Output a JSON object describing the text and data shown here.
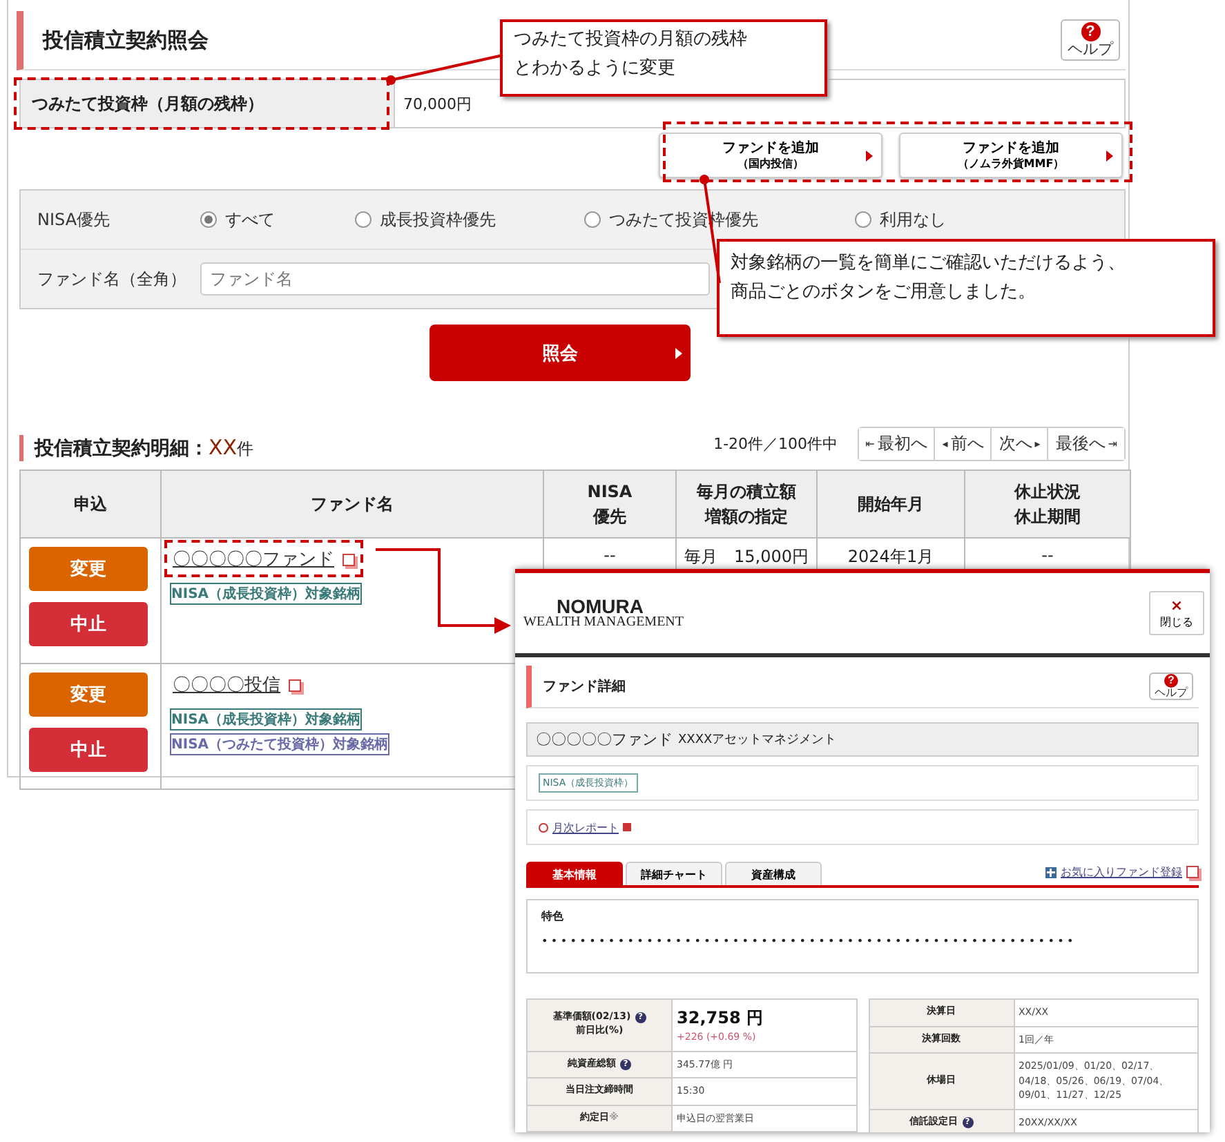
{
  "page": {
    "title": "投信積立契約照会",
    "help": {
      "label": "ヘルプ",
      "icon": "?"
    },
    "quota": {
      "label": "つみたて投資枠（月額の残枠）",
      "value": "70,000円"
    },
    "add_buttons": [
      {
        "line1": "ファンドを追加",
        "line2": "（国内投信）"
      },
      {
        "line1": "ファンドを追加",
        "line2": "（ノムラ外貨MMF）"
      }
    ],
    "filter": {
      "nisa_label": "NISA優先",
      "options": [
        {
          "label": "すべて",
          "selected": true
        },
        {
          "label": "成長投資枠優先",
          "selected": false
        },
        {
          "label": "つみたて投資枠優先",
          "selected": false
        },
        {
          "label": "利用なし",
          "selected": false
        }
      ],
      "fund_label": "ファンド名（全角）",
      "fund_placeholder": "ファンド名"
    },
    "submit": "照会",
    "details": {
      "title": "投信積立契約明細：",
      "count": "XX",
      "count_suffix": "件",
      "range": "1-20件／100件中",
      "pager": [
        {
          "label": "最初へ",
          "kind": "first",
          "icon": "⇤"
        },
        {
          "label": "前へ",
          "kind": "prev",
          "icon": "◂"
        },
        {
          "label": "次へ",
          "kind": "next",
          "icon": "▸"
        },
        {
          "label": "最後へ",
          "kind": "last",
          "icon": "⇥"
        }
      ]
    },
    "table": {
      "columns": [
        [
          "申込"
        ],
        [
          "ファンド名"
        ],
        [
          "NISA",
          "優先"
        ],
        [
          "毎月の積立額",
          "増額の指定"
        ],
        [
          "開始年月"
        ],
        [
          "休止状況",
          "休止期間"
        ]
      ],
      "rows": [
        {
          "apply": [
            {
              "label": "変更",
              "kind": "change"
            },
            {
              "label": "中止",
              "kind": "stop"
            }
          ],
          "fund": {
            "name": "〇〇〇〇〇ファンド",
            "tags": [
              {
                "label": "NISA（成長投資枠）対象銘柄",
                "color": "#3a7a78"
              }
            ]
          },
          "nisa": "--",
          "amount": "毎月　15,000円",
          "start": "2024年1月",
          "status": "--"
        },
        {
          "apply": [
            {
              "label": "変更",
              "kind": "change"
            },
            {
              "label": "中止",
              "kind": "stop"
            }
          ],
          "fund": {
            "name": "〇〇〇〇投信",
            "tags": [
              {
                "label": "NISA（成長投資枠）対象銘柄",
                "color": "#3a7a78"
              },
              {
                "label": "NISA（つみたて投資枠）対象銘柄",
                "color": "#6a6aa8"
              }
            ]
          }
        }
      ]
    }
  },
  "popup": {
    "logo": {
      "line1": "NOMURA",
      "line2": "WEALTH MANAGEMENT"
    },
    "close": {
      "icon": "×",
      "label": "閉じる"
    },
    "title": "ファンド詳細",
    "help": {
      "label": "ヘルプ",
      "icon": "?"
    },
    "fund_name": "〇〇〇〇〇ファンド",
    "company": "XXXXアセットマネジメント",
    "nisa_tag": "NISA（成長投資枠）",
    "report_link": "月次レポート",
    "tabs": [
      {
        "label": "基本情報",
        "selected": true
      },
      {
        "label": "詳細チャート",
        "selected": false
      },
      {
        "label": "資産構成",
        "selected": false
      }
    ],
    "favorite_link": "お気に入りファンド登録",
    "help_icon": "?",
    "feature": {
      "title": "特色",
      "text": "••••••••••••••••••••••••••••••••••••••••••••••••••••••••"
    },
    "left_table": [
      {
        "label": "基準価額(02/13)",
        "label2": "前日比(%)",
        "help": true,
        "value": "32,758 円",
        "change": "+226 (+0.69 %)",
        "kind": "price"
      },
      {
        "label": "純資産総額",
        "help": true,
        "value": "345.77億 円",
        "kind": "plain"
      },
      {
        "label": "当日注文締時間",
        "help": false,
        "value": "15:30",
        "kind": "plain"
      },
      {
        "label": "約定日",
        "note": "※",
        "help": false,
        "value": "申込日の翌営業日",
        "kind": "plain"
      }
    ],
    "right_table": [
      {
        "label": "決算日",
        "help": false,
        "value": "XX/XX"
      },
      {
        "label": "決算回数",
        "help": false,
        "value": "1回／年"
      },
      {
        "label": "休場日",
        "help": false,
        "value": "2025/01/09、01/20、02/17、04/18、05/26、06/19、07/04、09/01、11/27、12/25"
      },
      {
        "label": "信託設定日",
        "help": true,
        "value": "20XX/XX/XX"
      }
    ]
  },
  "callouts": [
    {
      "lines": [
        "つみたて投資枠の月額の残枠",
        "とわかるように変更"
      ]
    },
    {
      "lines": [
        "対象銘柄の一覧を簡単にご確認いただけるよう、",
        "商品ごとのボタンをご用意しました。"
      ]
    }
  ]
}
